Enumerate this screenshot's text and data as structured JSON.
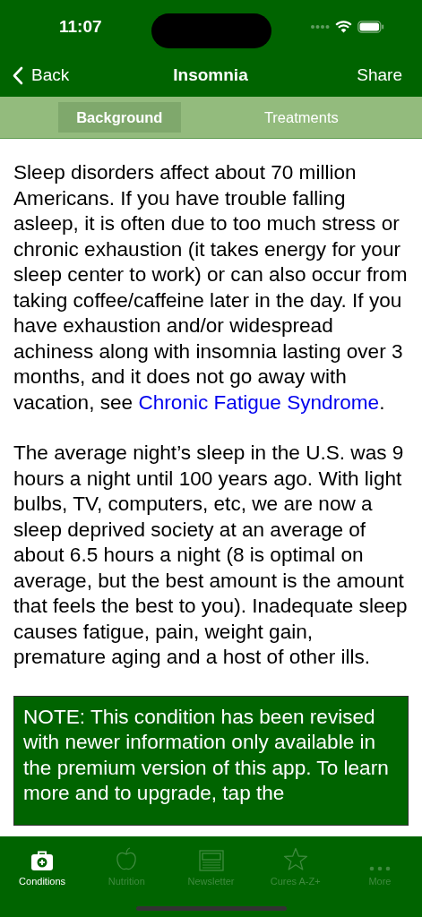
{
  "status_bar": {
    "time": "11:07"
  },
  "nav": {
    "back": "Back",
    "title": "Insomnia",
    "action": "Share"
  },
  "segments": [
    {
      "label": "Background",
      "selected": true
    },
    {
      "label": "Treatments",
      "selected": false
    }
  ],
  "paragraphs": [
    {
      "text": "Sleep disorders affect about 70 million Americans. If you have trouble falling asleep, it is often due to too much stress or chronic exhaustion (it takes energy for your sleep center to work) or can also occur from taking coffee/caffeine later in the day. If you have exhaustion and/or widespread achiness along with insomnia lasting over 3 months, and it does not go away with vacation, see ",
      "link": "Chronic Fatigue Syndrome",
      "after": "."
    },
    {
      "text": "The average night’s sleep in the U.S. was 9 hours a night until 100 years ago. With light bulbs, TV, computers, etc, we are now a sleep deprived society at an average of about 6.5 hours a night (8 is optimal on average, but the best amount is the amount that feels the best to you). Inadequate sleep causes fatigue, pain, weight gain, premature aging and a host of other ills."
    }
  ],
  "note": "NOTE: This condition has been revised with newer information only available in the premium version of this app. To learn more and to upgrade, tap the",
  "tab_bar": [
    {
      "label": "Conditions",
      "kind": "kit",
      "selected": true
    },
    {
      "label": "Nutrition",
      "kind": "apple",
      "selected": false
    },
    {
      "label": "Newsletter",
      "kind": "newspaper",
      "selected": false
    },
    {
      "label": "Cures A-Z+",
      "kind": "star",
      "selected": false
    },
    {
      "label": "More",
      "kind": "dots",
      "selected": false
    }
  ]
}
